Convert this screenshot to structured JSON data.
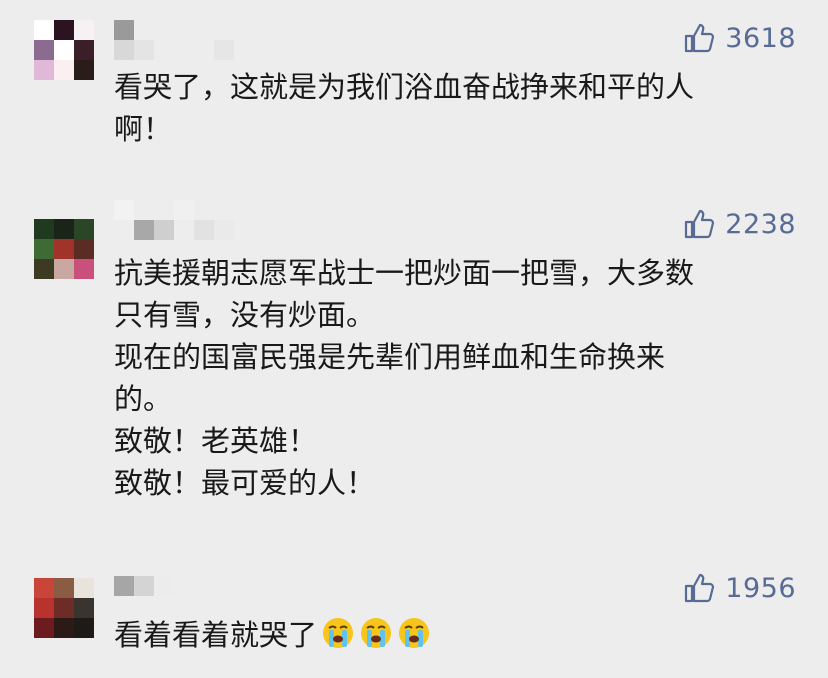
{
  "comments": [
    {
      "likes": "3618",
      "lines": [
        "看哭了，这就是为我们浴血奋战挣来和平的人",
        "啊！"
      ],
      "avatar_colors": [
        "#ffffff",
        "#2b1420",
        "#f7f1f3",
        "#8b6b90",
        "#ffffff",
        "#3a1f28",
        "#e0b8d8",
        "#fbeff2",
        "#2a1c18"
      ]
    },
    {
      "likes": "2238",
      "lines": [
        "抗美援朝志愿军战士一把炒面一把雪，大多数",
        "只有雪，没有炒面。",
        "现在的国富民强是先辈们用鲜血和生命换来",
        "的。",
        "致敬！老英雄！",
        "致敬！最可爱的人！"
      ],
      "avatar_colors": [
        "#1f3a1e",
        "#1a2418",
        "#2a4626",
        "#3e6a34",
        "#a0342a",
        "#5a2c24",
        "#3c3a22",
        "#c9a8a2",
        "#c8507a"
      ]
    },
    {
      "likes": "1956",
      "lines": [
        "看着看着就哭了"
      ],
      "emoji": [
        "loudly-crying-face-emoji",
        "loudly-crying-face-emoji",
        "loudly-crying-face-emoji"
      ],
      "avatar_colors": [
        "#c9453a",
        "#8a5c44",
        "#e8e4dc",
        "#b8322e",
        "#6e2c26",
        "#3a3430",
        "#6c1c1e",
        "#2c1a16",
        "#1e1a18"
      ]
    }
  ],
  "colors": {
    "like_blue": "#576b95",
    "text": "#191919",
    "background": "#ededed"
  },
  "icons": {
    "like": "thumbs-up-icon"
  }
}
